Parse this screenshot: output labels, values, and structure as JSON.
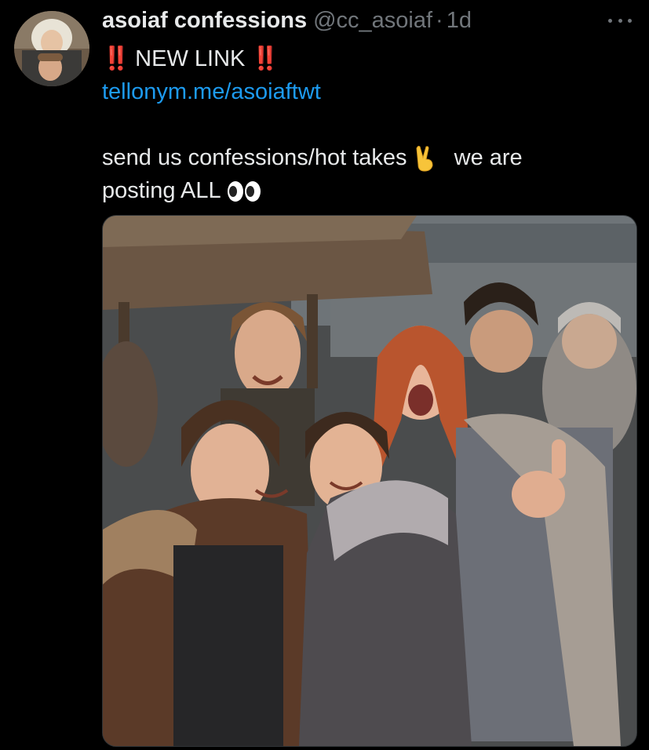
{
  "tweet": {
    "display_name": "asoiaf confessions",
    "handle": "@cc_asoiaf",
    "separator": "·",
    "time": "1d",
    "more_icon": "more-horizontal-icon",
    "lines": {
      "headline_prefix": "‼️",
      "headline_text": "NEW LINK",
      "headline_suffix": "‼️",
      "link": "tellonym.me/asoiaftwt",
      "body_part1": "send us confessions/hot takes",
      "body_emoji1": "victory-hand-emoji",
      "body_part2": "we are",
      "body_part3": "posting ALL",
      "body_emoji2": "eyes-emoji"
    },
    "media": {
      "type": "photo",
      "description_icon": "photo-of-group-in-fur-cloaks"
    }
  },
  "colors": {
    "background": "#000000",
    "text": "#e7e9ea",
    "secondary": "#71767b",
    "link": "#1d9bf0",
    "alert": "#e0142b"
  }
}
